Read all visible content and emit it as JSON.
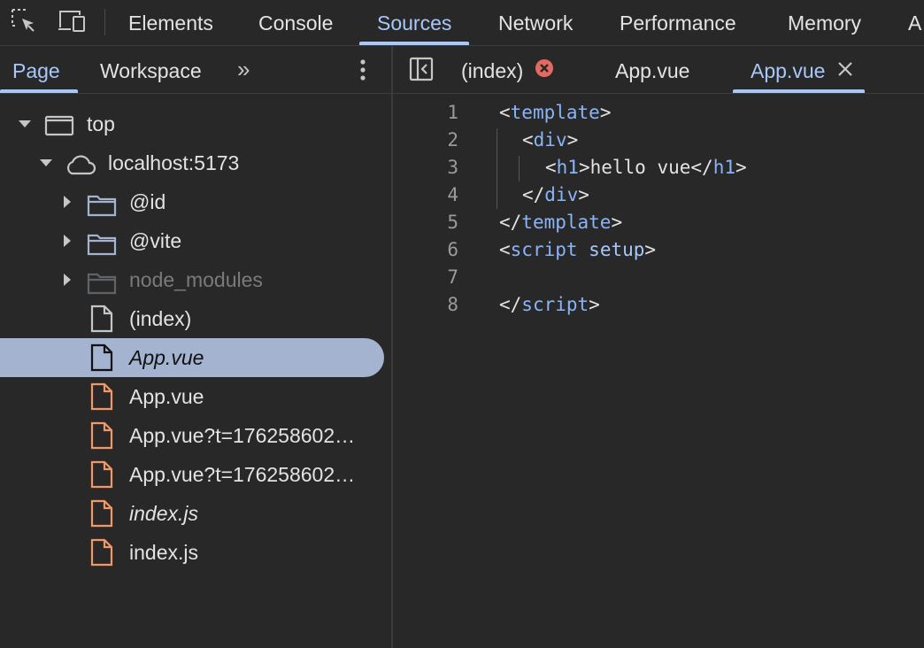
{
  "top_tabs": [
    "Elements",
    "Console",
    "Sources",
    "Network",
    "Performance",
    "Memory",
    "A"
  ],
  "active_top_tab": "Sources",
  "nav_tabs": {
    "page": "Page",
    "workspace": "Workspace",
    "more": "»"
  },
  "tree": {
    "top": "top",
    "host": "localhost:5173",
    "folders": [
      "@id",
      "@vite",
      "node_modules"
    ],
    "files": [
      "(index)",
      "App.vue",
      "App.vue",
      "App.vue?t=176258602…",
      "App.vue?t=176258602…",
      "index.js",
      "index.js"
    ]
  },
  "editor_tabs": [
    "(index)",
    "App.vue",
    "App.vue"
  ],
  "code_lines": [
    {
      "n": "1"
    },
    {
      "n": "2"
    },
    {
      "n": "3"
    },
    {
      "n": "4"
    },
    {
      "n": "5"
    },
    {
      "n": "6"
    },
    {
      "n": "7"
    },
    {
      "n": "8"
    }
  ],
  "code": {
    "l1_tag": "template",
    "l2_tag": "div",
    "l3_tag": "h1",
    "l3_text": "hello vue",
    "l6_tag": "script",
    "l6_attr": "setup"
  },
  "colors": {
    "accent": "#a8c7fa",
    "selected_row": "#a4b3cf",
    "file_orange": "#f29766",
    "error_red": "#e46962"
  }
}
